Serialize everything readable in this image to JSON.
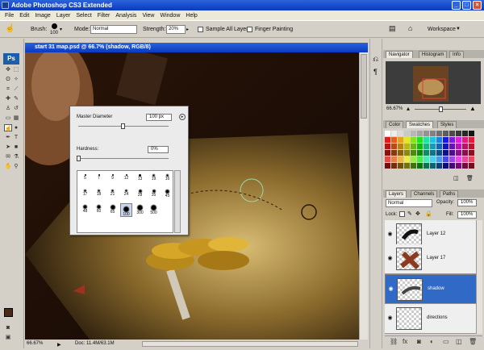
{
  "app": {
    "title": "Adobe Photoshop CS3 Extended"
  },
  "menu": [
    "File",
    "Edit",
    "Image",
    "Layer",
    "Select",
    "Filter",
    "Analysis",
    "View",
    "Window",
    "Help"
  ],
  "options": {
    "brush_label": "Brush:",
    "brush_size": "100",
    "mode_label": "Mode:",
    "mode_value": "Normal",
    "strength_label": "Strength:",
    "strength_value": "20%",
    "sample_all_layers": "Sample All Layers",
    "finger_painting": "Finger Painting",
    "workspace": "Workspace"
  },
  "toolbox": {
    "badge": "Ps"
  },
  "document": {
    "title": "start 31 map.psd @ 66.7% (shadow, RGB/8)",
    "zoom": "66.67%",
    "doc_info": "Doc: 11.4M/63.1M"
  },
  "brush_popup": {
    "master_diameter_label": "Master Diameter",
    "master_diameter_value": "100 px",
    "hardness_label": "Hardness:",
    "hardness_value": "0%",
    "brushes": [
      "5",
      "7",
      "9",
      "12",
      "13",
      "19",
      "16",
      "17",
      "18",
      "21",
      "24",
      "28",
      "35",
      "45",
      "48",
      "60",
      "65",
      "100",
      "300",
      "500"
    ]
  },
  "navigator": {
    "tabs": [
      "Navigator",
      "Histogram",
      "Info"
    ],
    "zoom": "66.67%"
  },
  "swatches": {
    "tabs": [
      "Color",
      "Swatches",
      "Styles"
    ]
  },
  "layers": {
    "tabs": [
      "Layers",
      "Channels",
      "Paths"
    ],
    "blend_mode": "Normal",
    "opacity_label": "Opacity:",
    "opacity_value": "100%",
    "lock_label": "Lock:",
    "fill_label": "Fill:",
    "fill_value": "100%",
    "items": [
      {
        "name": "Layer 12"
      },
      {
        "name": "Layer 17"
      },
      {
        "name": "shadow"
      },
      {
        "name": "directions"
      }
    ]
  },
  "colors": {
    "titlebar": "#0a3ac2",
    "selected_layer": "#3169c6",
    "ps_badge": "#1e5da8"
  }
}
